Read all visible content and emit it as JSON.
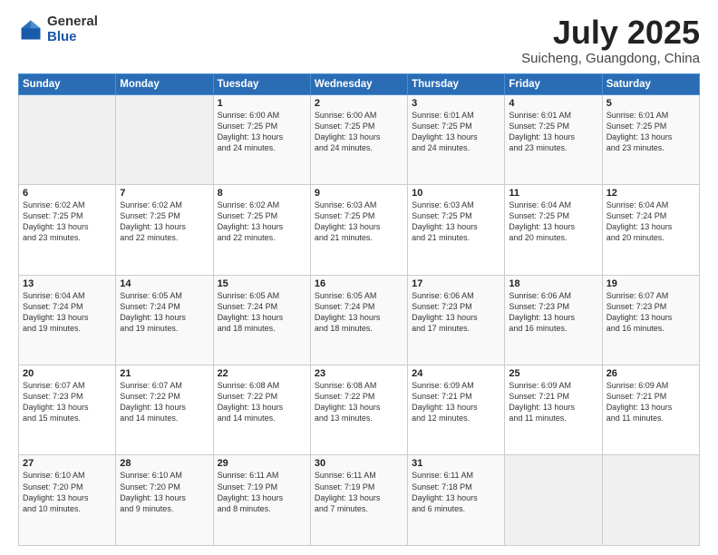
{
  "header": {
    "logo_general": "General",
    "logo_blue": "Blue",
    "title": "July 2025",
    "location": "Suicheng, Guangdong, China"
  },
  "weekdays": [
    "Sunday",
    "Monday",
    "Tuesday",
    "Wednesday",
    "Thursday",
    "Friday",
    "Saturday"
  ],
  "weeks": [
    [
      {
        "day": "",
        "info": ""
      },
      {
        "day": "",
        "info": ""
      },
      {
        "day": "1",
        "info": "Sunrise: 6:00 AM\nSunset: 7:25 PM\nDaylight: 13 hours\nand 24 minutes."
      },
      {
        "day": "2",
        "info": "Sunrise: 6:00 AM\nSunset: 7:25 PM\nDaylight: 13 hours\nand 24 minutes."
      },
      {
        "day": "3",
        "info": "Sunrise: 6:01 AM\nSunset: 7:25 PM\nDaylight: 13 hours\nand 24 minutes."
      },
      {
        "day": "4",
        "info": "Sunrise: 6:01 AM\nSunset: 7:25 PM\nDaylight: 13 hours\nand 23 minutes."
      },
      {
        "day": "5",
        "info": "Sunrise: 6:01 AM\nSunset: 7:25 PM\nDaylight: 13 hours\nand 23 minutes."
      }
    ],
    [
      {
        "day": "6",
        "info": "Sunrise: 6:02 AM\nSunset: 7:25 PM\nDaylight: 13 hours\nand 23 minutes."
      },
      {
        "day": "7",
        "info": "Sunrise: 6:02 AM\nSunset: 7:25 PM\nDaylight: 13 hours\nand 22 minutes."
      },
      {
        "day": "8",
        "info": "Sunrise: 6:02 AM\nSunset: 7:25 PM\nDaylight: 13 hours\nand 22 minutes."
      },
      {
        "day": "9",
        "info": "Sunrise: 6:03 AM\nSunset: 7:25 PM\nDaylight: 13 hours\nand 21 minutes."
      },
      {
        "day": "10",
        "info": "Sunrise: 6:03 AM\nSunset: 7:25 PM\nDaylight: 13 hours\nand 21 minutes."
      },
      {
        "day": "11",
        "info": "Sunrise: 6:04 AM\nSunset: 7:25 PM\nDaylight: 13 hours\nand 20 minutes."
      },
      {
        "day": "12",
        "info": "Sunrise: 6:04 AM\nSunset: 7:24 PM\nDaylight: 13 hours\nand 20 minutes."
      }
    ],
    [
      {
        "day": "13",
        "info": "Sunrise: 6:04 AM\nSunset: 7:24 PM\nDaylight: 13 hours\nand 19 minutes."
      },
      {
        "day": "14",
        "info": "Sunrise: 6:05 AM\nSunset: 7:24 PM\nDaylight: 13 hours\nand 19 minutes."
      },
      {
        "day": "15",
        "info": "Sunrise: 6:05 AM\nSunset: 7:24 PM\nDaylight: 13 hours\nand 18 minutes."
      },
      {
        "day": "16",
        "info": "Sunrise: 6:05 AM\nSunset: 7:24 PM\nDaylight: 13 hours\nand 18 minutes."
      },
      {
        "day": "17",
        "info": "Sunrise: 6:06 AM\nSunset: 7:23 PM\nDaylight: 13 hours\nand 17 minutes."
      },
      {
        "day": "18",
        "info": "Sunrise: 6:06 AM\nSunset: 7:23 PM\nDaylight: 13 hours\nand 16 minutes."
      },
      {
        "day": "19",
        "info": "Sunrise: 6:07 AM\nSunset: 7:23 PM\nDaylight: 13 hours\nand 16 minutes."
      }
    ],
    [
      {
        "day": "20",
        "info": "Sunrise: 6:07 AM\nSunset: 7:23 PM\nDaylight: 13 hours\nand 15 minutes."
      },
      {
        "day": "21",
        "info": "Sunrise: 6:07 AM\nSunset: 7:22 PM\nDaylight: 13 hours\nand 14 minutes."
      },
      {
        "day": "22",
        "info": "Sunrise: 6:08 AM\nSunset: 7:22 PM\nDaylight: 13 hours\nand 14 minutes."
      },
      {
        "day": "23",
        "info": "Sunrise: 6:08 AM\nSunset: 7:22 PM\nDaylight: 13 hours\nand 13 minutes."
      },
      {
        "day": "24",
        "info": "Sunrise: 6:09 AM\nSunset: 7:21 PM\nDaylight: 13 hours\nand 12 minutes."
      },
      {
        "day": "25",
        "info": "Sunrise: 6:09 AM\nSunset: 7:21 PM\nDaylight: 13 hours\nand 11 minutes."
      },
      {
        "day": "26",
        "info": "Sunrise: 6:09 AM\nSunset: 7:21 PM\nDaylight: 13 hours\nand 11 minutes."
      }
    ],
    [
      {
        "day": "27",
        "info": "Sunrise: 6:10 AM\nSunset: 7:20 PM\nDaylight: 13 hours\nand 10 minutes."
      },
      {
        "day": "28",
        "info": "Sunrise: 6:10 AM\nSunset: 7:20 PM\nDaylight: 13 hours\nand 9 minutes."
      },
      {
        "day": "29",
        "info": "Sunrise: 6:11 AM\nSunset: 7:19 PM\nDaylight: 13 hours\nand 8 minutes."
      },
      {
        "day": "30",
        "info": "Sunrise: 6:11 AM\nSunset: 7:19 PM\nDaylight: 13 hours\nand 7 minutes."
      },
      {
        "day": "31",
        "info": "Sunrise: 6:11 AM\nSunset: 7:18 PM\nDaylight: 13 hours\nand 6 minutes."
      },
      {
        "day": "",
        "info": ""
      },
      {
        "day": "",
        "info": ""
      }
    ]
  ]
}
